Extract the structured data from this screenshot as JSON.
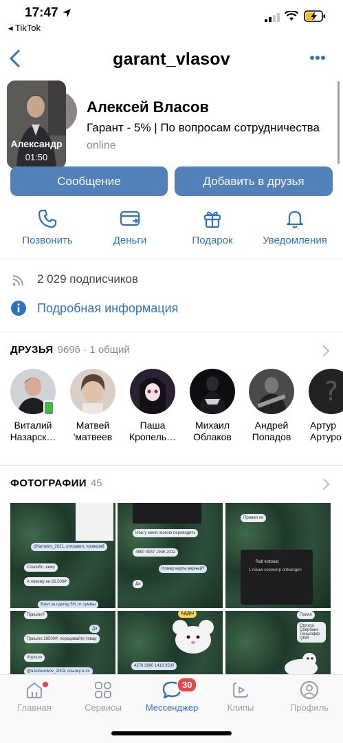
{
  "status_bar": {
    "time": "17:47",
    "back_app": "◂ TikTok"
  },
  "nav": {
    "title": "garant_vlasov",
    "more_icon": "more-horizontal-icon"
  },
  "story": {
    "name": "Александр",
    "time": "01:50"
  },
  "profile": {
    "name": "Алексей Власов",
    "status": "Гарант - 5% | По вопросам сотрудничества",
    "online": "online"
  },
  "buttons": {
    "message": "Сообщение",
    "add_friend": "Добавить в друзья"
  },
  "actions": [
    {
      "label": "Позвонить",
      "icon": "phone-icon"
    },
    {
      "label": "Деньги",
      "icon": "money-transfer-icon"
    },
    {
      "label": "Подарок",
      "icon": "gift-icon"
    },
    {
      "label": "Уведомления",
      "icon": "bell-icon"
    }
  ],
  "info": {
    "followers": "2 029 подписчиков",
    "details": "Подробная информация"
  },
  "friends": {
    "title": "ДРУЗЬЯ",
    "count": "9696 · 1 общий",
    "items": [
      {
        "line1": "Виталий",
        "line2": "Назарск…"
      },
      {
        "line1": "Матвей",
        "line2": "'матвеев"
      },
      {
        "line1": "Паша",
        "line2": "Кропель…"
      },
      {
        "line1": "Михаил",
        "line2": "Облаков"
      },
      {
        "line1": "Андрей",
        "line2": "Попадов"
      },
      {
        "line1": "Артур",
        "line2": "Артуро"
      }
    ]
  },
  "photos": {
    "title": "ФОТОГРАФИИ",
    "count": "45",
    "p1": {
      "a": "@famelov_2021, отправил, проверяй",
      "b": "Спасибо, вижу",
      "c": "А почему не 26.500₽",
      "d": "Взял за сделку 5% от суммы"
    },
    "p2": {
      "a": "Нож у меня, можно переводить",
      "b": "4890 4947 1946 2012",
      "c": "Номер карты верный?",
      "d": "Да"
    },
    "p3": {
      "a": "Принял он",
      "b": "Rutl voltooid",
      "c": "1 nieuw voorwerp ontvangen"
    },
    "p4": {
      "a": "Пришли?",
      "b": "Да",
      "c": "Пришло 26500₽, передавайте товар",
      "d": "Хорошо",
      "e": "@a.kolesnikov_2003, ссылку в лс"
    },
    "p5": {
      "a": "АДДЫ",
      "b": "4276 3900 1419 3530"
    },
    "p6": {
      "a": "Понял",
      "b": "Оплата Сбербанк Тинькофф QIWI"
    }
  },
  "tabbar": {
    "tabs": [
      {
        "label": "Главная",
        "icon": "home-icon"
      },
      {
        "label": "Сервисы",
        "icon": "services-grid-icon"
      },
      {
        "label": "Мессенджер",
        "icon": "messenger-icon"
      },
      {
        "label": "Клипы",
        "icon": "clips-icon"
      },
      {
        "label": "Профиль",
        "icon": "profile-icon"
      }
    ],
    "badge": "30"
  },
  "colors": {
    "accent": "#2b73c9",
    "button": "#5181b8",
    "badge": "#e64646"
  }
}
